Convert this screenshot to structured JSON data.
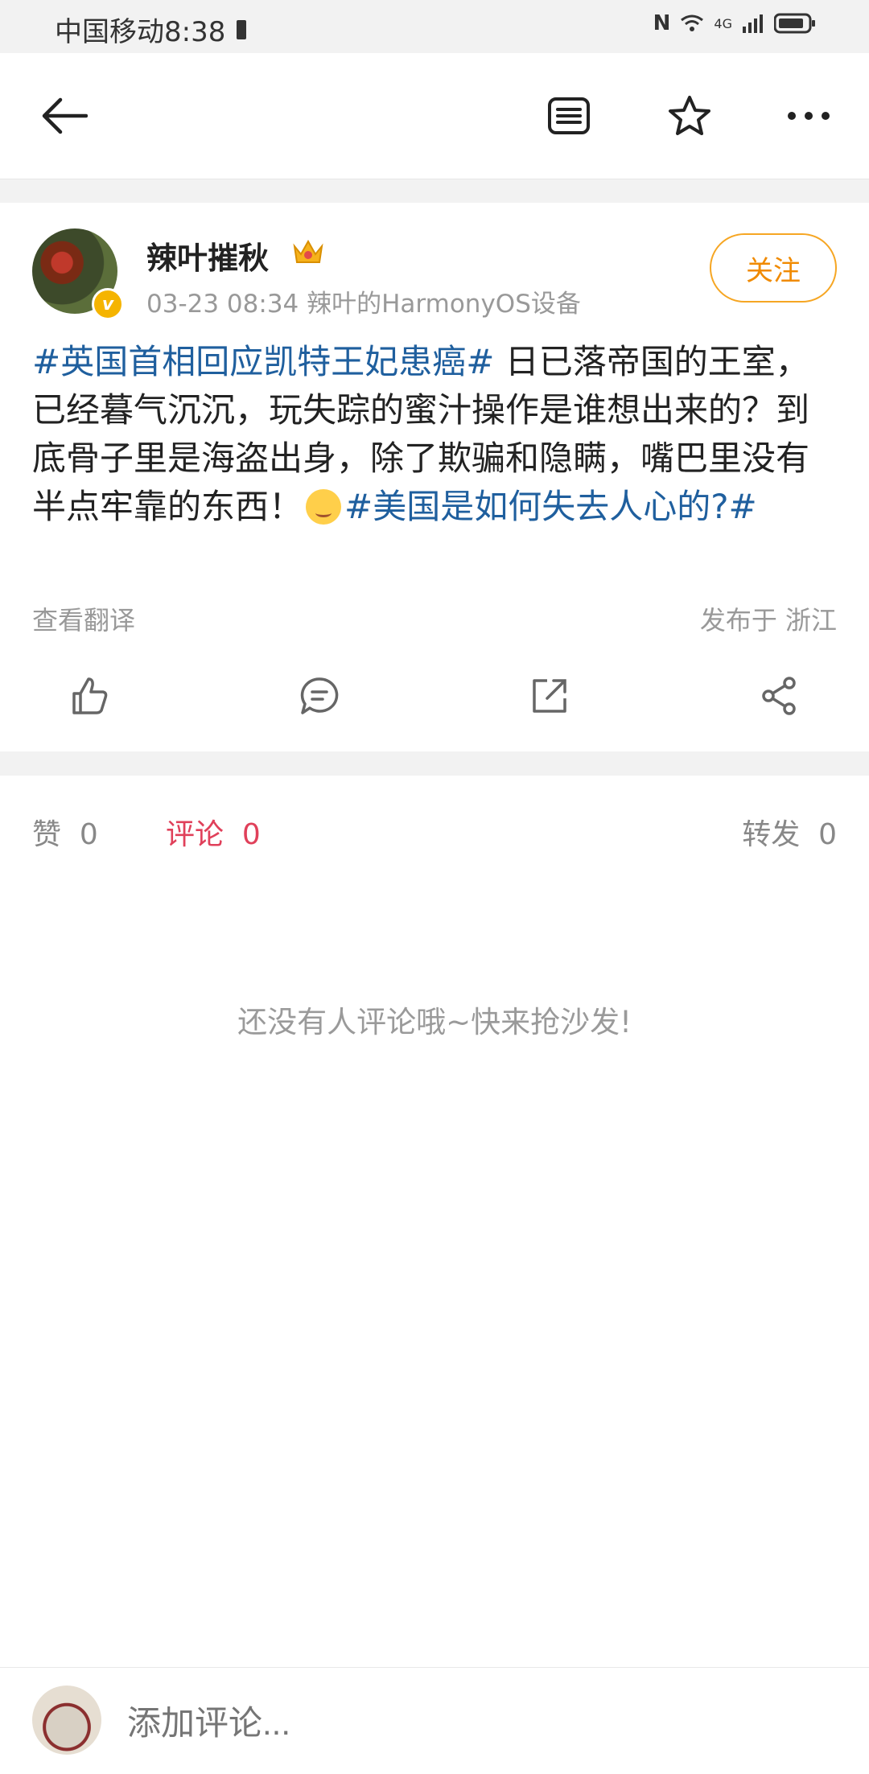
{
  "status_bar": {
    "carrier_time": "中国移动8:38",
    "network": "4G"
  },
  "top_bar": {
    "icons": [
      "back-arrow-icon",
      "list-icon",
      "star-icon",
      "more-icon"
    ]
  },
  "post": {
    "username": "辣叶摧秋",
    "meta": "03-23 08:34   辣叶的HarmonyOS设备",
    "follow_label": "关注",
    "content": {
      "hashtag1": "#英国首相回应凯特王妃患癌#",
      "text1": " 日已落帝国的王室，已经暮气沉沉，玩失踪的蜜汁操作是谁想出来的？到底骨子里是海盗出身，除了欺骗和隐瞒，嘴巴里没有半点牢靠的东西！",
      "hashtag2": "#美国是如何失去人心的?#"
    },
    "translate_label": "查看翻译",
    "location": "发布于 浙江"
  },
  "tabs": {
    "like_label": "赞",
    "like_count": "0",
    "comment_label": "评论",
    "comment_count": "0",
    "repost_label": "转发",
    "repost_count": "0"
  },
  "empty_message": "还没有人评论哦~快来抢沙发!",
  "comment_box": {
    "placeholder": "添加评论..."
  },
  "colors": {
    "accent_red": "#e0405a",
    "link_blue": "#1f5f9e",
    "follow_orange": "#f08a00"
  }
}
